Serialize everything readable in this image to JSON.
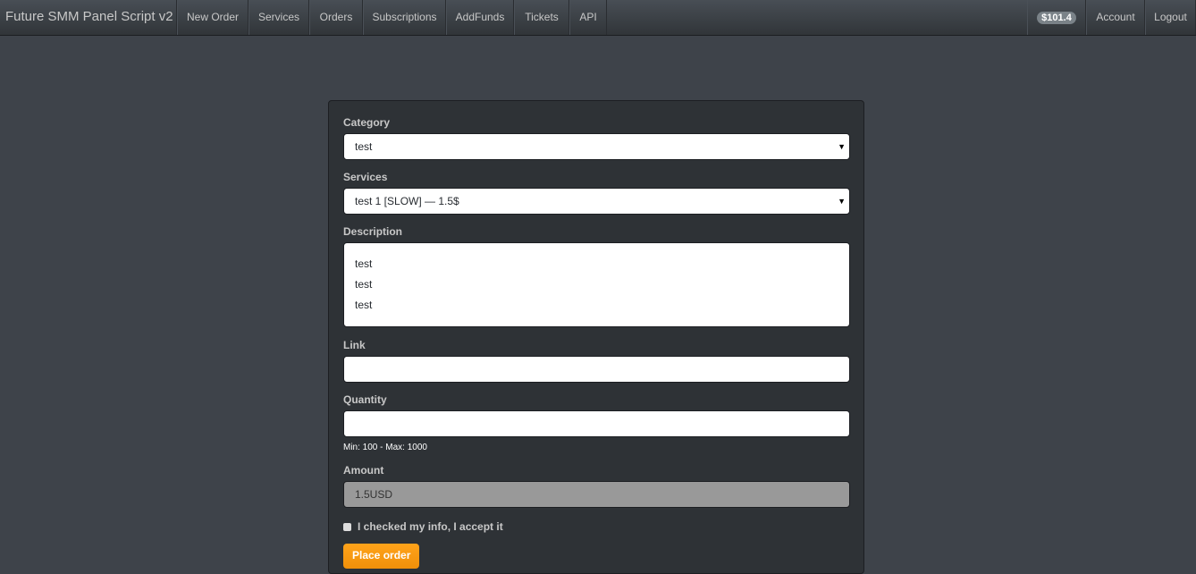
{
  "nav": {
    "brand": "Future SMM Panel Script v2",
    "items": [
      "New Order",
      "Services",
      "Orders",
      "Subscriptions",
      "AddFunds",
      "Tickets",
      "API"
    ],
    "balance": "$101.4",
    "account": "Account",
    "logout": "Logout"
  },
  "form": {
    "category_label": "Category",
    "category_value": "test",
    "services_label": "Services",
    "services_value": "test 1 [SLOW] — 1.5$",
    "description_label": "Description",
    "description_lines": [
      "test",
      "test",
      "test"
    ],
    "link_label": "Link",
    "link_value": "",
    "quantity_label": "Quantity",
    "quantity_value": "",
    "quantity_help": "Min: 100 - Max: 1000",
    "amount_label": "Amount",
    "amount_value": "1.5USD",
    "accept_label": "I checked my info, I accept it",
    "submit": "Place order"
  },
  "colors": {
    "accent": "#f7950f",
    "background": "#3e434a",
    "panel": "#2e3236"
  }
}
